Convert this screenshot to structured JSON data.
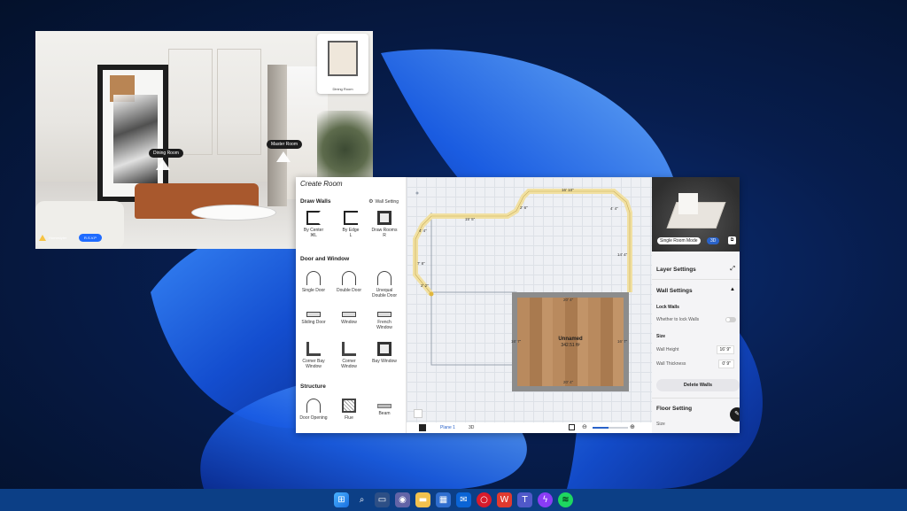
{
  "viewer": {
    "hotspots": [
      "Dining Room",
      "Master Room"
    ],
    "minimap_label": "Dining Room",
    "brand": "Homestyler",
    "button": "R.S.V.P"
  },
  "editor": {
    "title": "Create Room",
    "draw_walls": {
      "title": "Draw Walls",
      "wall_setting": "Wall Setting",
      "tools": [
        {
          "label": "By Center",
          "shortcut": "⌘L"
        },
        {
          "label": "By Edge",
          "shortcut": "L"
        },
        {
          "label": "Draw Rooms",
          "shortcut": "R"
        }
      ]
    },
    "door_window": {
      "title": "Door and Window",
      "tools": [
        "Single Door",
        "Double Door",
        "Unequal Double Door",
        "Sliding Door",
        "Window",
        "French Window",
        "Corner Bay Window",
        "Corner Window",
        "Bay Window"
      ]
    },
    "structure": {
      "title": "Structure",
      "tools": [
        "Door Opening",
        "Flue",
        "Beam"
      ]
    },
    "canvas": {
      "room_name": "Unnamed",
      "room_area": "342.51 ft²",
      "dimensions": [
        "16' 10\"",
        "15' 5\"",
        "4' 4\"",
        "2' 6\"",
        "14' 4\"",
        "7' 8\"",
        "2' 2\"",
        "20' 4\"",
        "20' 4\"",
        "16' 7\"",
        "16' 7\"",
        "4' 4\""
      ],
      "plane": "Plane 1",
      "mode": "3D",
      "zoom_level": 0.45
    },
    "right_panel": {
      "preview_mode": "Single Room Mode",
      "preview_3d": "3D",
      "layer_settings": "Layer Settings",
      "wall_settings": "Wall Settings",
      "lock_walls": "Lock Walls",
      "lock_walls_desc": "Whether to lock Walls",
      "size": "Size",
      "wall_height_label": "Wall Height",
      "wall_height": "16' 9\"",
      "wall_thickness_label": "Wall Thickness",
      "wall_thickness": "0' 9\"",
      "delete_walls": "Delete Walls",
      "floor_setting": "Floor Setting",
      "floor_size": "Size"
    }
  },
  "taskbar": {
    "icons": [
      "windows-start-icon",
      "search-icon",
      "task-view-icon",
      "teams-chat-icon",
      "file-explorer-icon",
      "store-icon",
      "mail-icon",
      "opera-icon",
      "wps-icon",
      "teams-icon",
      "messenger-icon",
      "spotify-icon"
    ]
  }
}
